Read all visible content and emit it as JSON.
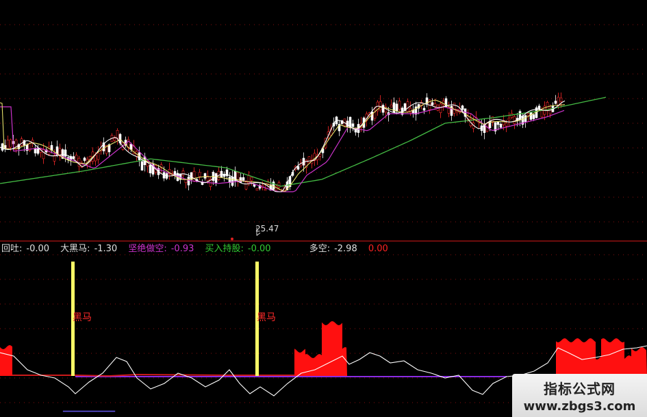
{
  "legend": {
    "huitu_label": "回吐:",
    "huitu_value": "-0.00",
    "daheima_label": "大黑马:",
    "daheima_value": "-1.30",
    "jianjue_label": "坚绝做空:",
    "jianjue_value": "-0.93",
    "mairu_label": "买入持股:",
    "mairu_value": "-0.00",
    "duokong_label": "多空:",
    "duokong_value": "-2.98",
    "extra_value": "0.00"
  },
  "price_marker": "25.47",
  "markers": [
    {
      "label": "黑马"
    },
    {
      "label": "黑马"
    }
  ],
  "watermark": {
    "title": "指标公式网",
    "url": "www.zbgs3.com"
  },
  "colors": {
    "background": "#000000",
    "grid": "#8a1010",
    "candle_up": "#ff2a2a",
    "candle_down": "#ffffff",
    "ma_white": "#ffffff",
    "ma_yellow": "#e8e36a",
    "ma_purple": "#cc33cc",
    "ma_green": "#44bb44",
    "signal_bar": "#ffff66",
    "red_area": "#ff1010",
    "purple_line": "#8a2be2",
    "huitu_color": "#e0e0e0",
    "daheima_color": "#e0e0e0",
    "jianjue_color": "#cc33cc",
    "mairu_color": "#33cc33",
    "duokong_color": "#e0e0e0",
    "extra_color": "#ff2222"
  }
}
